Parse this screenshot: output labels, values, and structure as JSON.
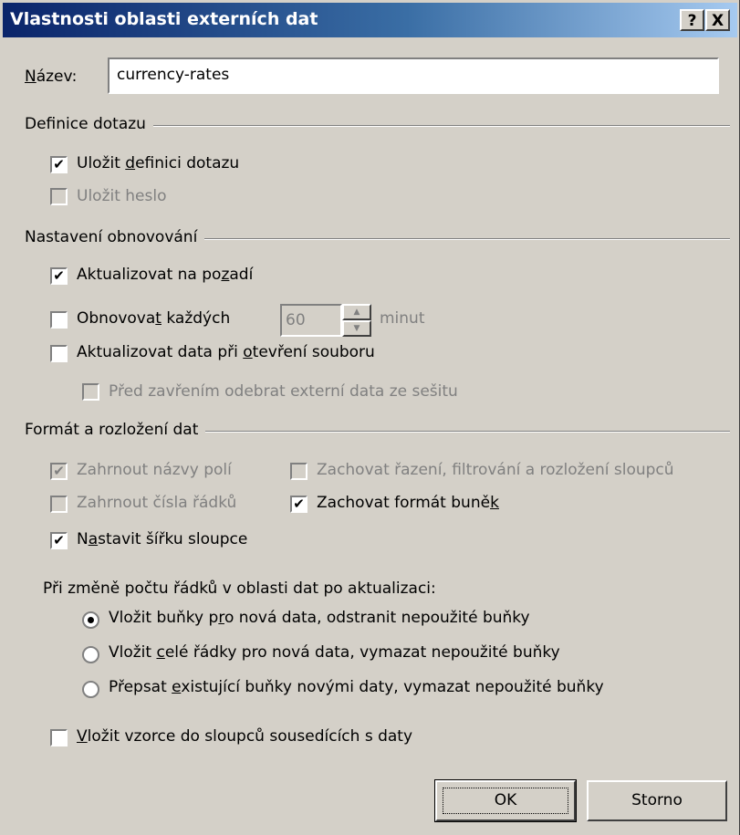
{
  "dialog": {
    "title": "Vlastnosti oblasti externích dat",
    "help_button": "?",
    "close_button": "X"
  },
  "name": {
    "label_u": "N",
    "label_rest": "ázev:",
    "value": "currency-rates"
  },
  "query_definition": {
    "group_label": "Definice dotazu",
    "save_query": {
      "pre": "Uložit ",
      "u": "d",
      "post": "efinici dotazu",
      "checked": true
    },
    "save_password": {
      "label": "Uložit heslo",
      "checked": false,
      "disabled": true
    }
  },
  "refresh": {
    "group_label": "Nastavení obnovování",
    "background": {
      "pre": "Aktualizovat na po",
      "u": "z",
      "post": "adí",
      "checked": true
    },
    "every": {
      "pre": "Obnovova",
      "u": "t",
      "post": " každých",
      "checked": false,
      "value": "60",
      "unit": "minut"
    },
    "on_open": {
      "pre": "Aktualizovat data při ",
      "u": "o",
      "post": "tevření souboru",
      "checked": false
    },
    "remove_before_close": {
      "label": "Před zavřením odebrat externí data ze sešitu",
      "checked": false,
      "disabled": true
    }
  },
  "format": {
    "group_label": "Formát a rozložení dat",
    "include_field_names": {
      "label": "Zahrnout názvy polí",
      "checked": true,
      "disabled": true
    },
    "preserve_sort": {
      "label": "Zachovat řazení, filtrování a rozložení sloupců",
      "checked": false,
      "disabled": true
    },
    "include_row_numbers": {
      "label": "Zahrnout čísla řádků",
      "checked": false,
      "disabled": true
    },
    "preserve_cell_format": {
      "pre": "Zachovat formát buně",
      "u": "k",
      "post": "",
      "checked": true
    },
    "adjust_width": {
      "pre": "N",
      "u": "a",
      "post": "stavit šířku sloupce",
      "checked": true
    },
    "rows_change_label": "Při změně počtu řádků v oblasti dat po aktualizaci:",
    "radio_insert_cells": {
      "pre": "Vložit buňky p",
      "u": "r",
      "post": "o nová data, odstranit nepoužité buňky",
      "selected": true
    },
    "radio_insert_rows": {
      "pre": "Vložit ",
      "u": "c",
      "post": "elé řádky pro nová data, vymazat nepoužité buňky",
      "selected": false
    },
    "radio_overwrite": {
      "pre": "Přepsat ",
      "u": "e",
      "post": "xistující buňky novými daty, vymazat nepoužité buňky",
      "selected": false
    },
    "fill_formulas": {
      "pre": "",
      "u": "V",
      "post": "ložit vzorce do sloupců sousedících s daty",
      "checked": false
    }
  },
  "buttons": {
    "ok": "OK",
    "cancel": "Storno"
  },
  "glyphs": {
    "check": "✔",
    "spin_up": "▲",
    "spin_down": "▼"
  }
}
